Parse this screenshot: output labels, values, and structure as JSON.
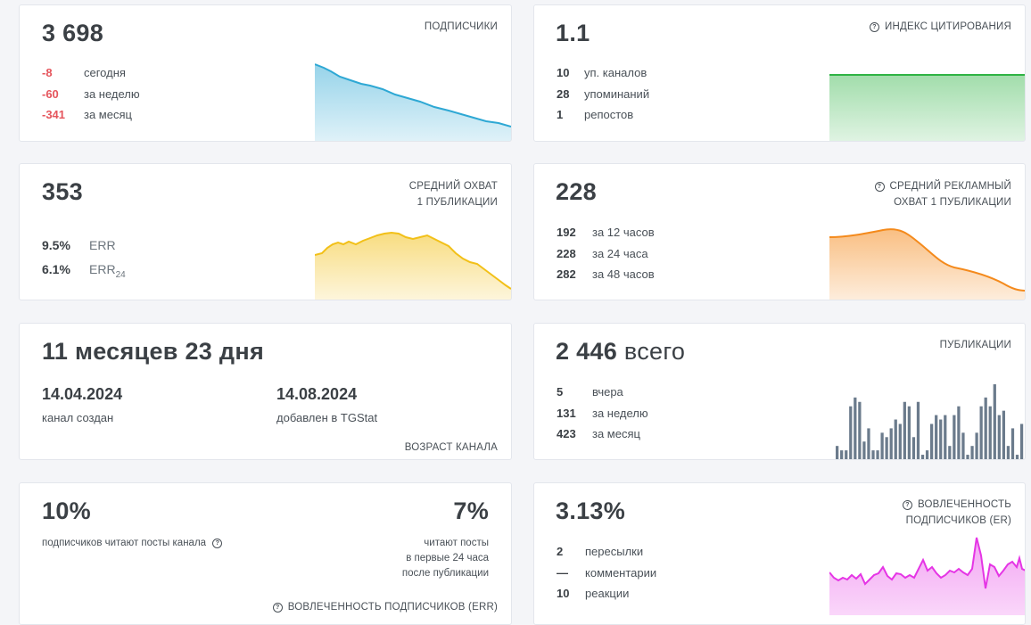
{
  "subscribers": {
    "value": "3 698",
    "label": "ПОДПИСЧИКИ",
    "stats": [
      {
        "value": "-8",
        "text": "сегодня"
      },
      {
        "value": "-60",
        "text": "за неделю"
      },
      {
        "value": "-341",
        "text": "за месяц"
      }
    ],
    "color": "#2ea8d4"
  },
  "citation": {
    "value": "1.1",
    "label": "ИНДЕКС ЦИТИРОВАНИЯ",
    "stats": [
      {
        "value": "10",
        "text": "уп. каналов"
      },
      {
        "value": "28",
        "text": "упоминаний"
      },
      {
        "value": "1",
        "text": "репостов"
      }
    ],
    "color": "#2fb344"
  },
  "reach": {
    "value": "353",
    "label_line1": "СРЕДНИЙ ОХВАТ",
    "label_line2": "1 ПУБЛИКАЦИИ",
    "stats": [
      {
        "value": "9.5%",
        "text": "ERR",
        "sub": ""
      },
      {
        "value": "6.1%",
        "text": "ERR",
        "sub": "24"
      }
    ],
    "color": "#f2c018"
  },
  "ad_reach": {
    "value": "228",
    "label_line1": "СРЕДНИЙ РЕКЛАМНЫЙ",
    "label_line2": "ОХВАТ 1 ПУБЛИКАЦИИ",
    "stats": [
      {
        "value": "192",
        "text": "за 12 часов"
      },
      {
        "value": "228",
        "text": "за 24 часа"
      },
      {
        "value": "282",
        "text": "за 48 часов"
      }
    ],
    "color": "#f48a1c"
  },
  "age": {
    "value": "11 месяцев 23 дня",
    "created_date": "14.04.2024",
    "created_label": "канал создан",
    "added_date": "14.08.2024",
    "added_label": "добавлен в TGStat",
    "label": "ВОЗРАСТ КАНАЛА"
  },
  "publications": {
    "value": "2 446",
    "suffix": "всего",
    "label": "ПУБЛИКАЦИИ",
    "stats": [
      {
        "value": "5",
        "text": "вчера"
      },
      {
        "value": "131",
        "text": "за неделю"
      },
      {
        "value": "423",
        "text": "за месяц"
      }
    ],
    "color": "#6b7b8c",
    "bars": [
      3,
      2,
      2,
      12,
      14,
      13,
      4,
      7,
      2,
      2,
      6,
      5,
      7,
      9,
      8,
      13,
      12,
      5,
      13,
      1,
      2,
      8,
      10,
      9,
      10,
      3,
      10,
      12,
      6,
      1,
      3,
      6,
      12,
      14,
      12,
      17,
      10,
      11,
      3,
      7,
      1,
      8
    ]
  },
  "reading": {
    "value1": "10%",
    "text1": "подписчиков читают посты канала",
    "value2": "7%",
    "text2_line1": "читают посты",
    "text2_line2": "в первые 24 часа",
    "text2_line3": "после публикации",
    "label": "ВОВЛЕЧЕННОСТЬ ПОДПИСЧИКОВ (ERR)"
  },
  "engagement": {
    "value": "3.13%",
    "label_line1": "ВОВЛЕЧЕННОСТЬ",
    "label_line2": "ПОДПИСЧИКОВ (ER)",
    "stats": [
      {
        "value": "2",
        "text": "пересылки"
      },
      {
        "value": "—",
        "text": "комментарии"
      },
      {
        "value": "10",
        "text": "реакции"
      }
    ],
    "color": "#e535e5"
  },
  "icons": {
    "question": "question-circle-icon"
  }
}
